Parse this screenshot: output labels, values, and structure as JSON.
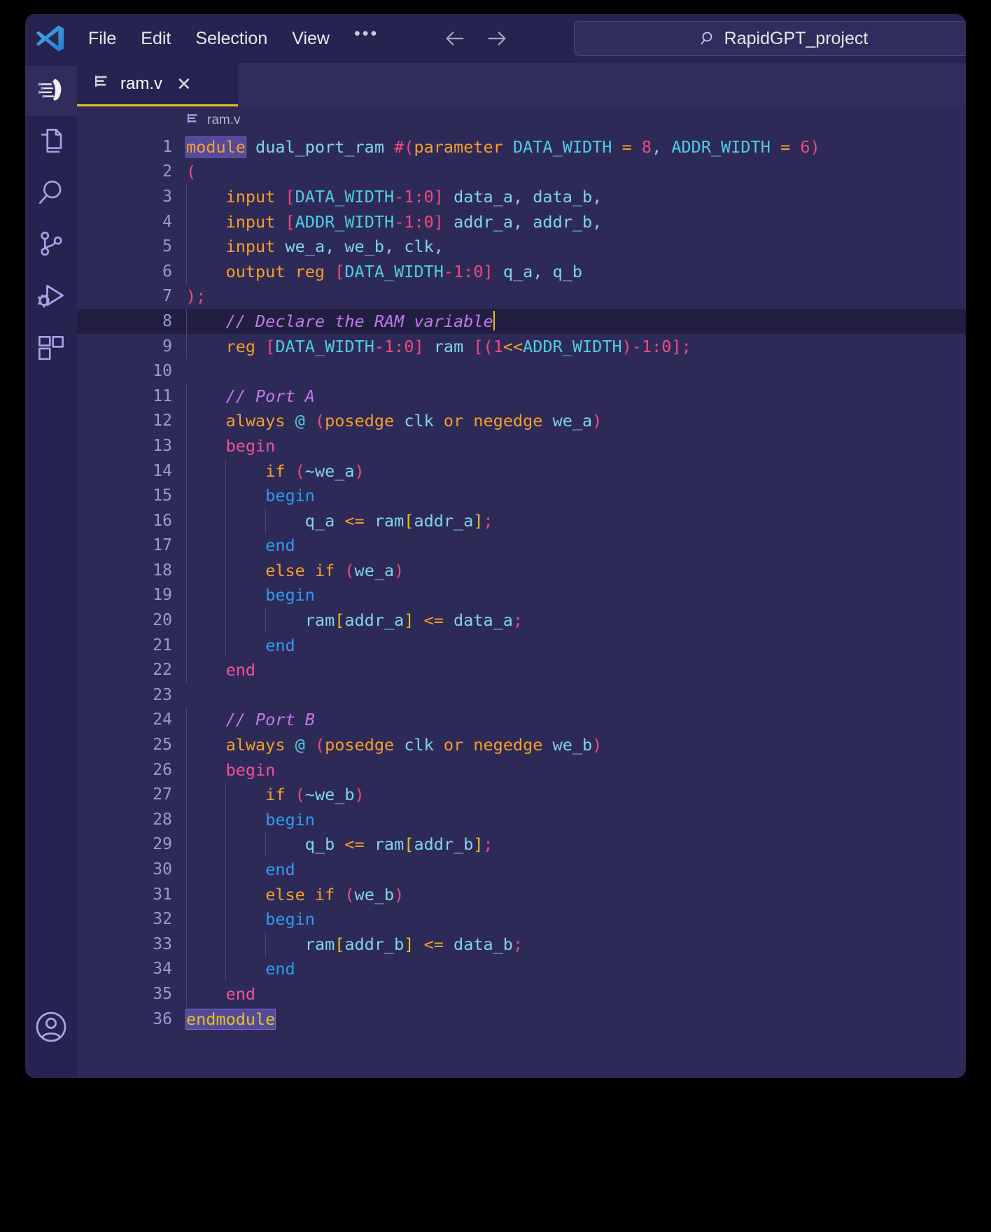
{
  "window": {
    "app": "Visual Studio Code"
  },
  "titlebar": {
    "logo_icon": "vscode-logo-icon",
    "menu": [
      {
        "label": "File"
      },
      {
        "label": "Edit"
      },
      {
        "label": "Selection"
      },
      {
        "label": "View"
      }
    ],
    "more_label": "•••",
    "back_icon": "arrow-left-icon",
    "forward_icon": "arrow-right-icon",
    "search": {
      "icon": "search-icon",
      "value": "RapidGPT_project"
    }
  },
  "activitybar": {
    "items": [
      {
        "name": "rapidgpt-logo",
        "icon": "rapidgpt-logo-icon",
        "active": true
      },
      {
        "name": "explorer",
        "icon": "files-icon"
      },
      {
        "name": "search",
        "icon": "search-icon"
      },
      {
        "name": "source-control",
        "icon": "source-control-icon"
      },
      {
        "name": "run-and-debug",
        "icon": "run-debug-icon"
      },
      {
        "name": "extensions",
        "icon": "extensions-icon"
      }
    ],
    "account": {
      "name": "account",
      "icon": "account-icon"
    }
  },
  "tabs": [
    {
      "label": "ram.v",
      "file_icon": "verilog-file-icon",
      "close_icon": "close-icon",
      "active": true
    }
  ],
  "breadcrumb": {
    "file_icon": "verilog-file-icon",
    "label": "ram.v"
  },
  "editor": {
    "language": "verilog",
    "active_line": 8,
    "cursor_line": 8,
    "colors": {
      "background": "#2e2a58",
      "active_line_background": "#211e42",
      "chrome": "#262350",
      "keyword": "#f59e2a",
      "type": "#4ecde0",
      "number": "#f2497d",
      "comment": "#c07ae8",
      "begin_outer": "#f2509b",
      "begin_inner": "#2e9bf0",
      "bracket_yellow": "#e6c219",
      "tab_accent": "#e6c219",
      "word_match": "#544a9c"
    },
    "lines": [
      {
        "n": 1,
        "indent": 0,
        "text": "module dual_port_ram #(parameter DATA_WIDTH = 8, ADDR_WIDTH = 6)"
      },
      {
        "n": 2,
        "indent": 0,
        "text": "("
      },
      {
        "n": 3,
        "indent": 1,
        "text": "    input [DATA_WIDTH-1:0] data_a, data_b,"
      },
      {
        "n": 4,
        "indent": 1,
        "text": "    input [ADDR_WIDTH-1:0] addr_a, addr_b,"
      },
      {
        "n": 5,
        "indent": 1,
        "text": "    input we_a, we_b, clk,"
      },
      {
        "n": 6,
        "indent": 1,
        "text": "    output reg [DATA_WIDTH-1:0] q_a, q_b"
      },
      {
        "n": 7,
        "indent": 0,
        "text": ");"
      },
      {
        "n": 8,
        "indent": 1,
        "text": "    // Declare the RAM variable"
      },
      {
        "n": 9,
        "indent": 1,
        "text": "    reg [DATA_WIDTH-1:0] ram [(1<<ADDR_WIDTH)-1:0];"
      },
      {
        "n": 10,
        "indent": 0,
        "text": ""
      },
      {
        "n": 11,
        "indent": 1,
        "text": "    // Port A"
      },
      {
        "n": 12,
        "indent": 1,
        "text": "    always @ (posedge clk or negedge we_a)"
      },
      {
        "n": 13,
        "indent": 1,
        "text": "    begin"
      },
      {
        "n": 14,
        "indent": 2,
        "text": "        if (~we_a)"
      },
      {
        "n": 15,
        "indent": 2,
        "text": "        begin"
      },
      {
        "n": 16,
        "indent": 3,
        "text": "            q_a <= ram[addr_a];"
      },
      {
        "n": 17,
        "indent": 2,
        "text": "        end"
      },
      {
        "n": 18,
        "indent": 2,
        "text": "        else if (we_a)"
      },
      {
        "n": 19,
        "indent": 2,
        "text": "        begin"
      },
      {
        "n": 20,
        "indent": 3,
        "text": "            ram[addr_a] <= data_a;"
      },
      {
        "n": 21,
        "indent": 2,
        "text": "        end"
      },
      {
        "n": 22,
        "indent": 1,
        "text": "    end"
      },
      {
        "n": 23,
        "indent": 0,
        "text": ""
      },
      {
        "n": 24,
        "indent": 1,
        "text": "    // Port B"
      },
      {
        "n": 25,
        "indent": 1,
        "text": "    always @ (posedge clk or negedge we_b)"
      },
      {
        "n": 26,
        "indent": 1,
        "text": "    begin"
      },
      {
        "n": 27,
        "indent": 2,
        "text": "        if (~we_b)"
      },
      {
        "n": 28,
        "indent": 2,
        "text": "        begin"
      },
      {
        "n": 29,
        "indent": 3,
        "text": "            q_b <= ram[addr_b];"
      },
      {
        "n": 30,
        "indent": 2,
        "text": "        end"
      },
      {
        "n": 31,
        "indent": 2,
        "text": "        else if (we_b)"
      },
      {
        "n": 32,
        "indent": 2,
        "text": "        begin"
      },
      {
        "n": 33,
        "indent": 3,
        "text": "            ram[addr_b] <= data_b;"
      },
      {
        "n": 34,
        "indent": 2,
        "text": "        end"
      },
      {
        "n": 35,
        "indent": 1,
        "text": "    end"
      },
      {
        "n": 36,
        "indent": 0,
        "text": "endmodule"
      }
    ]
  }
}
